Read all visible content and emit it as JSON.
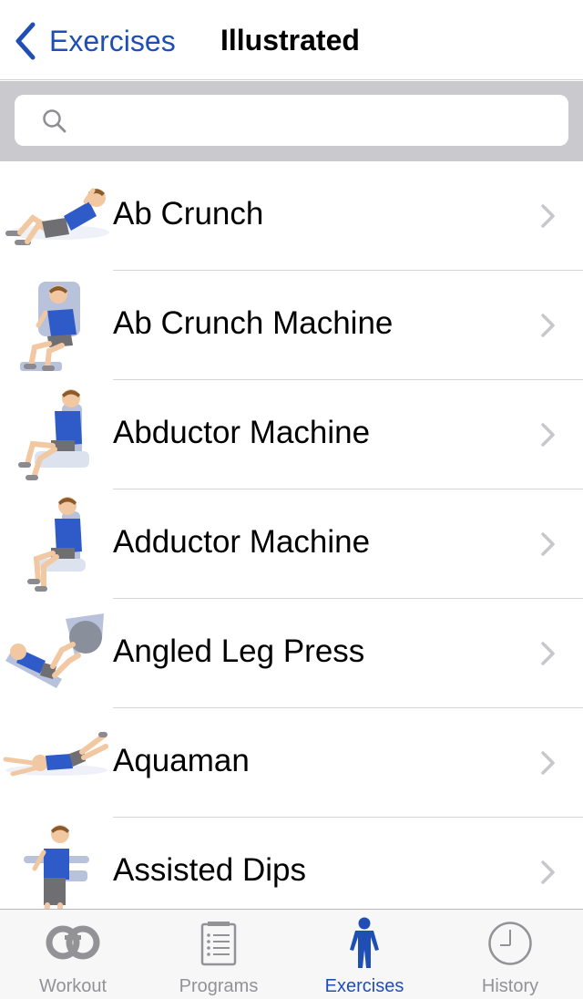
{
  "navbar": {
    "back_label": "Exercises",
    "title": "Illustrated"
  },
  "search": {
    "placeholder": "",
    "value": ""
  },
  "exercises": [
    {
      "label": "Ab Crunch",
      "icon": "ab-crunch-illustration"
    },
    {
      "label": "Ab Crunch Machine",
      "icon": "ab-crunch-machine-illustration"
    },
    {
      "label": "Abductor Machine",
      "icon": "abductor-machine-illustration"
    },
    {
      "label": "Adductor Machine",
      "icon": "adductor-machine-illustration"
    },
    {
      "label": "Angled Leg Press",
      "icon": "angled-leg-press-illustration"
    },
    {
      "label": "Aquaman",
      "icon": "aquaman-illustration"
    },
    {
      "label": "Assisted Dips",
      "icon": "assisted-dips-illustration"
    }
  ],
  "tabbar": {
    "active": "Exercises",
    "tabs": [
      {
        "label": "Workout",
        "icon": "rings-icon"
      },
      {
        "label": "Programs",
        "icon": "list-icon"
      },
      {
        "label": "Exercises",
        "icon": "person-icon"
      },
      {
        "label": "History",
        "icon": "clock-icon"
      }
    ]
  },
  "colors": {
    "accent": "#1f4fb4",
    "shirt": "#2f5bc9",
    "shorts": "#6e6e73",
    "skin": "#f2c8a2",
    "hair": "#8a5a2b",
    "equipment": "#b8c2da",
    "searchbar_bg": "#c9c9ce",
    "tab_inactive": "#929297"
  }
}
